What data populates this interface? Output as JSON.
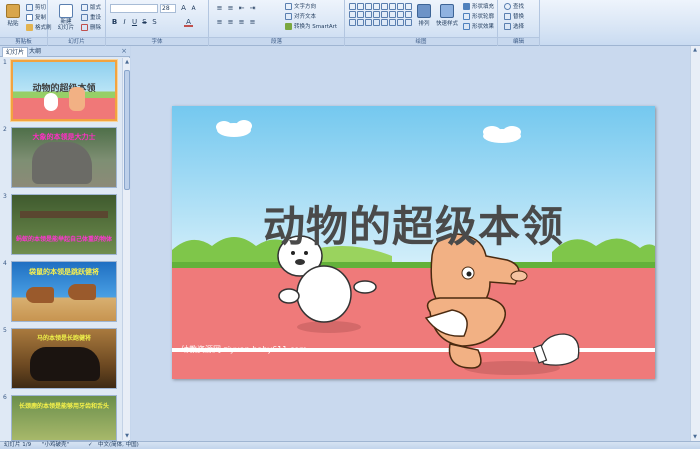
{
  "ribbon": {
    "clipboard": {
      "paste": "粘贴",
      "cut": "剪切",
      "copy": "复制",
      "format_painter": "格式刷",
      "label": "剪贴板"
    },
    "slides": {
      "new_slide": "新建\n幻灯片",
      "layout": "版式",
      "reset": "重设",
      "delete": "删除",
      "label": "幻灯片"
    },
    "font": {
      "size": "28",
      "label": "字体"
    },
    "paragraph": {
      "text_direction": "文字方向",
      "align_text": "对齐文本",
      "convert_smartart": "转换为 SmartArt",
      "label": "段落"
    },
    "drawing": {
      "arrange": "排列",
      "quick_styles": "快速样式",
      "shape_fill": "形状填充",
      "shape_outline": "形状轮廓",
      "shape_effects": "形状效果",
      "label": "绘图"
    },
    "editing": {
      "find": "查找",
      "replace": "替换",
      "select": "选择",
      "label": "编辑"
    }
  },
  "panel": {
    "tab_slides": "幻灯片",
    "tab_outline": "大纲",
    "close": "×",
    "thumbnails": [
      {
        "num": "1",
        "title": "动物的超级本领"
      },
      {
        "num": "2",
        "title": "大象的本领是大力士"
      },
      {
        "num": "3",
        "title": "蚂蚁的本领是能举起自己体重的物体"
      },
      {
        "num": "4",
        "title": "袋鼠的本领是跳跃健将"
      },
      {
        "num": "5",
        "title": "马的本领是长跑健将"
      },
      {
        "num": "6",
        "title": "长颈鹿的本领是能够用牙齿和舌头"
      }
    ]
  },
  "slide": {
    "title": "动物的超级本领",
    "watermark": "幼教资源网 ziyuan.baby611.com"
  },
  "status": {
    "slide_count": "幻灯片 1/9",
    "theme": "\"小鸡破壳\"",
    "language": "中文(简体, 中国)"
  }
}
